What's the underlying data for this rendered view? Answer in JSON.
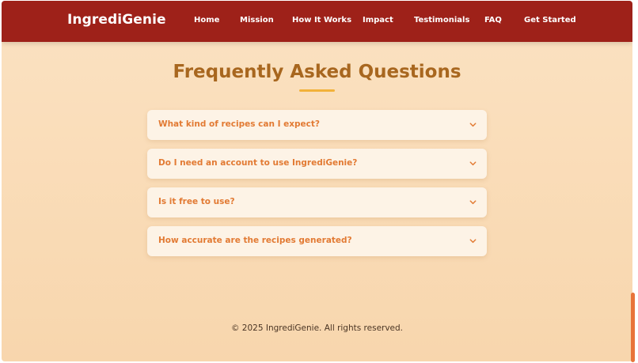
{
  "header": {
    "brand": "IngrediGenie",
    "nav": [
      "Home",
      "Mission",
      "How It Works",
      "Impact",
      "Testimonials",
      "FAQ",
      "Get Started"
    ]
  },
  "faq": {
    "title": "Frequently Asked Questions",
    "questions": [
      "What kind of recipes can I expect?",
      "Do I need an account to use IngrediGenie?",
      "Is it free to use?",
      "How accurate are the recipes generated?"
    ],
    "expand_icon": "chevron-down-icon"
  },
  "footer": {
    "copyright": "© 2025 IngrediGenie. All rights reserved."
  },
  "colors": {
    "navbar": "#9e2119",
    "title": "#a8671f",
    "accent": "#f2b23a",
    "question": "#e27a33",
    "card": "#fdf3e6",
    "background": "#f9dab4",
    "scrollbar": "#e8743a"
  }
}
